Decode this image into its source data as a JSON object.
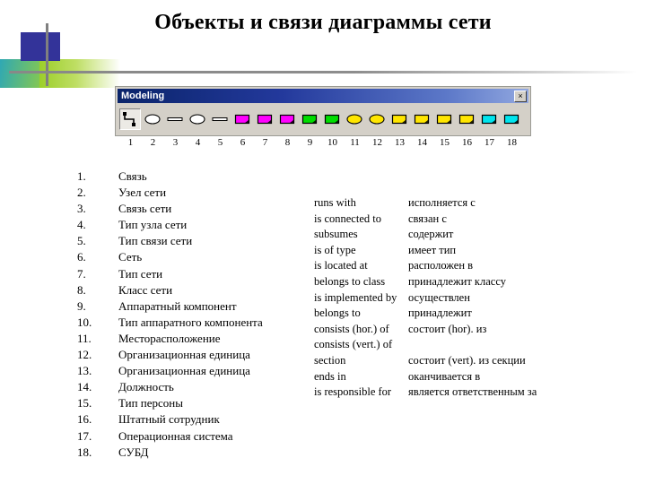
{
  "page_title": "Объекты и связи диаграммы сети",
  "decoration": {
    "name": "corner-accent",
    "colors": {
      "blue": "#333399",
      "teal": "#2fa8b4",
      "green": "#9ccf2a",
      "line": "#808080"
    }
  },
  "toolbar": {
    "title": "Modeling",
    "close_label": "×",
    "icons": [
      {
        "number": "1",
        "name": "connector-polyline",
        "shape": "polyline",
        "fill": "#000000",
        "selected": true
      },
      {
        "number": "2",
        "name": "ellipse-white",
        "shape": "ellipse",
        "fill": "#ffffff",
        "selected": false
      },
      {
        "number": "3",
        "name": "line-white",
        "shape": "bar",
        "fill": "#ffffff",
        "selected": false
      },
      {
        "number": "4",
        "name": "ellipse-white-2",
        "shape": "ellipse",
        "fill": "#ffffff",
        "selected": false
      },
      {
        "number": "5",
        "name": "line-white-2",
        "shape": "bar",
        "fill": "#ffffff",
        "selected": false
      },
      {
        "number": "6",
        "name": "rect-magenta",
        "shape": "rect",
        "fill": "#ff00ff",
        "selected": false
      },
      {
        "number": "7",
        "name": "rect-magenta-2",
        "shape": "rect",
        "fill": "#ff00ff",
        "selected": false
      },
      {
        "number": "8",
        "name": "rect-magenta-3",
        "shape": "rect",
        "fill": "#ff00ff",
        "selected": false
      },
      {
        "number": "9",
        "name": "rect-green",
        "shape": "rect",
        "fill": "#00dd00",
        "selected": false
      },
      {
        "number": "10",
        "name": "rect-green-2",
        "shape": "rect",
        "fill": "#00dd00",
        "selected": false
      },
      {
        "number": "11",
        "name": "ellipse-yellow",
        "shape": "ellipse",
        "fill": "#ffe600",
        "selected": false
      },
      {
        "number": "12",
        "name": "ellipse-yellow-2",
        "shape": "ellipse",
        "fill": "#ffe600",
        "selected": false
      },
      {
        "number": "13",
        "name": "rect-yellow",
        "shape": "rect",
        "fill": "#ffe600",
        "selected": false
      },
      {
        "number": "14",
        "name": "rect-yellow-2",
        "shape": "rect",
        "fill": "#ffe600",
        "selected": false
      },
      {
        "number": "15",
        "name": "rect-yellow-3",
        "shape": "rect",
        "fill": "#ffe600",
        "selected": false
      },
      {
        "number": "16",
        "name": "rect-yellow-4",
        "shape": "rect",
        "fill": "#ffe600",
        "selected": false
      },
      {
        "number": "17",
        "name": "rect-cyan",
        "shape": "rect",
        "fill": "#00e5ee",
        "selected": false
      },
      {
        "number": "18",
        "name": "rect-cyan-2",
        "shape": "rect",
        "fill": "#00e5ee",
        "selected": false
      }
    ]
  },
  "object_list": [
    {
      "number": "1.",
      "label": "Связь"
    },
    {
      "number": "2.",
      "label": "Узел сети"
    },
    {
      "number": "3.",
      "label": "Связь сети"
    },
    {
      "number": "4.",
      "label": "Тип узла сети"
    },
    {
      "number": "5.",
      "label": "Тип связи сети"
    },
    {
      "number": "6.",
      "label": "Сеть"
    },
    {
      "number": "7.",
      "label": "Тип сети"
    },
    {
      "number": "8.",
      "label": "Класс сети"
    },
    {
      "number": "9.",
      "label": "Аппаратный компонент"
    },
    {
      "number": "10.",
      "label": "Тип аппаратного компонента"
    },
    {
      "number": "11.",
      "label": "Месторасположение"
    },
    {
      "number": "12.",
      "label": "Организационная единица"
    },
    {
      "number": "13.",
      "label": "Организационная единица"
    },
    {
      "number": "14.",
      "label": "Должность"
    },
    {
      "number": "15.",
      "label": "Тип персоны"
    },
    {
      "number": "16.",
      "label": "Штатный сотрудник"
    },
    {
      "number": "17.",
      "label": "Операционная система"
    },
    {
      "number": "18.",
      "label": "СУБД"
    }
  ],
  "glossary": [
    {
      "en": "runs with",
      "ru": "исполняется с"
    },
    {
      "en": "is connected to",
      "ru": "связан с"
    },
    {
      "en": "subsumes",
      "ru": "содержит"
    },
    {
      "en": "is of type",
      "ru": "имеет тип"
    },
    {
      "en": "is located at",
      "ru": "расположен в"
    },
    {
      "en": "belongs to class",
      "ru": "принадлежит классу"
    },
    {
      "en": "is implemented by",
      "ru": "осуществлен"
    },
    {
      "en": "belongs to",
      "ru": "принадлежит"
    },
    {
      "en": "consists (hor.) of",
      "ru": "состоит (hor). из"
    },
    {
      "en": "consists (vert.) of",
      "ru": ""
    },
    {
      "en": "section",
      "ru": "состоит (vert). из секции"
    },
    {
      "en": "ends in",
      "ru": "оканчивается в"
    },
    {
      "en": "is responsible for",
      "ru": "является ответственным за"
    }
  ]
}
